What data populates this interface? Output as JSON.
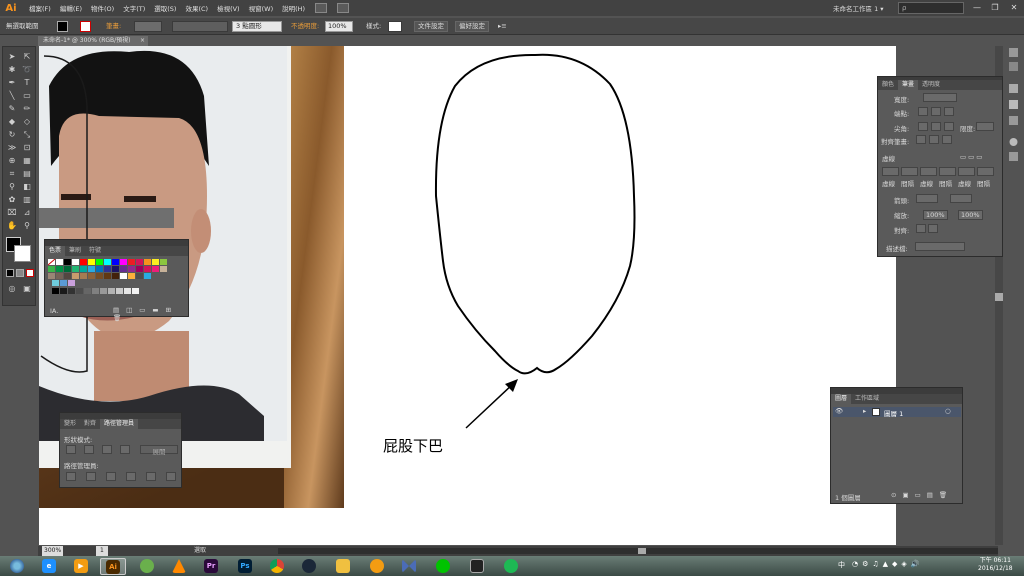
{
  "app": {
    "logo": "Ai",
    "menu": [
      "檔案(F)",
      "編輯(E)",
      "物件(O)",
      "文字(T)",
      "選取(S)",
      "效果(C)",
      "檢視(V)",
      "視窗(W)",
      "說明(H)"
    ],
    "workspace": "未命名工作區 1 ▾",
    "search_placeholder": "ρ",
    "window_controls": [
      "—",
      "❐",
      "✕"
    ]
  },
  "controlbar": {
    "selection": "無選取範圍",
    "stroke_label": "筆畫:",
    "brush": "3 點圓形",
    "opacity_label": "不透明度:",
    "opacity_value": "100%",
    "style_label": "樣式:",
    "doc_setup": "文件設定",
    "preferences": "偏好設定"
  },
  "document_tab": {
    "title": "未命名-1* @ 300% (RGB/預視)",
    "close": "×"
  },
  "annotation": {
    "text": "屁股下巴"
  },
  "swatches_panel": {
    "tabs": [
      "色票",
      "筆刷",
      "符號"
    ],
    "footer": "IA."
  },
  "pathfinder_panel": {
    "tabs": [
      "變形",
      "對齊",
      "路徑管理員"
    ],
    "shape_modes_label": "形狀模式:",
    "expand_label": "展開",
    "pathfinders_label": "路徑管理員:"
  },
  "stroke_panel": {
    "tabs": [
      "顏色",
      "筆畫",
      "透明度"
    ],
    "weight_label": "寬度:",
    "cap_label": "端點:",
    "corner_label": "尖角:",
    "limit_label": "限度:",
    "align_label": "對齊筆畫:",
    "dashed_label": "虛線",
    "dash_cells": [
      "虛線",
      "間隔",
      "虛線",
      "間隔",
      "虛線",
      "間隔"
    ],
    "arrow_label": "箭頭:",
    "scale_label": "縮放:",
    "scale_values": [
      "100%",
      "100%"
    ],
    "align2_label": "對齊:",
    "profile_label": "描述檔:"
  },
  "layers_panel": {
    "tabs": [
      "圖層",
      "工作區域"
    ],
    "layer_name": "圖層 1",
    "footer": "1 個圖層"
  },
  "statusbar": {
    "zoom": "300%",
    "page": "1",
    "status": "選取"
  },
  "taskbar": {
    "ime": "中",
    "time": "下午 06:11",
    "date": "2016/12/18"
  },
  "colors": {
    "ui_dark": "#424242",
    "panel": "#5a5a5a",
    "accent": "#f7931e",
    "artboard": "#ffffff"
  }
}
